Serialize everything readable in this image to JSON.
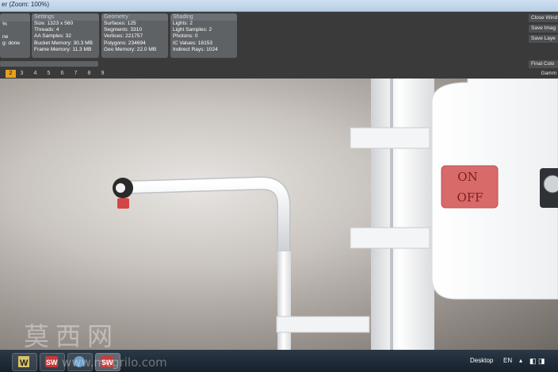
{
  "window": {
    "title": "er (Zoom: 100%)"
  },
  "stats": {
    "panel0": {
      "rows": [
        "%",
        "ne",
        "g: done"
      ]
    },
    "settings": {
      "title": "Settings",
      "rows": [
        "Size: 1323 x 560",
        "Threads: 4",
        "AA Samples: 32",
        "Bucket Memory: 30.3 MB",
        "Frame Memory: 11.3 MB"
      ]
    },
    "geometry": {
      "title": "Geometry",
      "rows": [
        "Surfaces: 125",
        "Segments: 3310",
        "Vertices: 221757",
        "Polygons: 234694",
        "Geo Memory: 22.0 MB"
      ]
    },
    "shading": {
      "title": "Shading",
      "rows": [
        "Lights: 2",
        "Light Samples: 2",
        "Photons: 0",
        "IC Values: 18153",
        "Indirect Rays: 1024"
      ]
    }
  },
  "pages": [
    "2",
    "3",
    "4",
    "5",
    "6",
    "7",
    "8",
    "9"
  ],
  "right_buttons": [
    "Close Wind",
    "Save Imag",
    "Save Laye",
    "Final Colo",
    "Gamm"
  ],
  "render": {
    "on_label": "ON",
    "off_label": "OFF"
  },
  "taskbar": {
    "desktop": "Desktop",
    "lang": "EN"
  },
  "watermark": {
    "text": "莫西网",
    "url": "www.mcgrilo.com"
  },
  "colors": {
    "accent": "#e8a020",
    "switch_red": "#d86a6a"
  }
}
